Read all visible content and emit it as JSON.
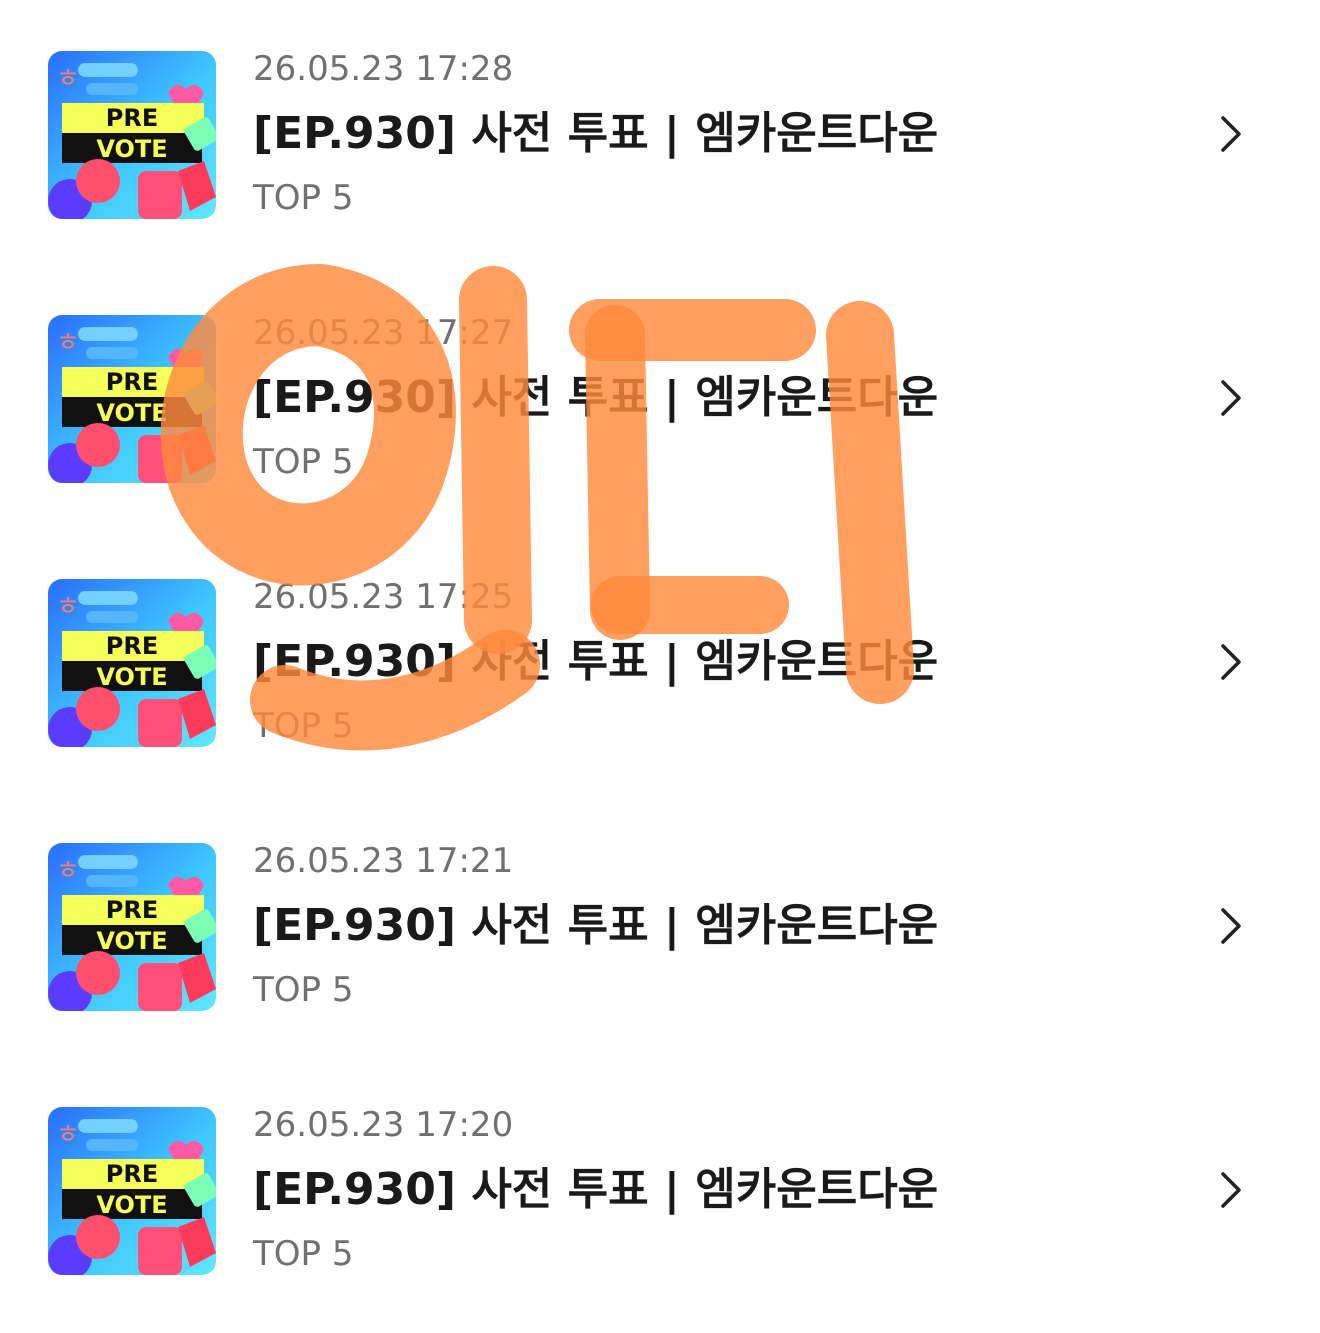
{
  "list": {
    "items": [
      {
        "timestamp": "26.05.23 17:28",
        "title": "[EP.930] 사전 투표 | 엠카운트다운",
        "subtitle": "TOP 5",
        "thumb_text_top": "PRE",
        "thumb_text_bottom": "VOTE",
        "thumb_glyph": "ㅎ"
      },
      {
        "timestamp": "26.05.23 17:27",
        "title": "[EP.930] 사전 투표 | 엠카운트다운",
        "subtitle": "TOP 5",
        "thumb_text_top": "PRE",
        "thumb_text_bottom": "VOTE",
        "thumb_glyph": "ㅎ"
      },
      {
        "timestamp": "26.05.23 17:25",
        "title": "[EP.930] 사전 투표 | 엠카운트다운",
        "subtitle": "TOP 5",
        "thumb_text_top": "PRE",
        "thumb_text_bottom": "VOTE",
        "thumb_glyph": "ㅎ"
      },
      {
        "timestamp": "26.05.23 17:21",
        "title": "[EP.930] 사전 투표 | 엠카운트다운",
        "subtitle": "TOP 5",
        "thumb_text_top": "PRE",
        "thumb_text_bottom": "VOTE",
        "thumb_glyph": "ㅎ"
      },
      {
        "timestamp": "26.05.23 17:20",
        "title": "[EP.930] 사전 투표 | 엠카운트다운",
        "subtitle": "TOP 5",
        "thumb_text_top": "PRE",
        "thumb_text_bottom": "VOTE",
        "thumb_glyph": "ㅎ"
      }
    ]
  },
  "overlay": {
    "handwritten_text": "인디",
    "color": "#ff8a3d"
  },
  "icons": {
    "row_action": "chevron-right-icon"
  },
  "colors": {
    "thumb_background": "#3fa7ff",
    "thumb_banner": "#f5ff5a",
    "thumb_banner_text": "#111111"
  }
}
